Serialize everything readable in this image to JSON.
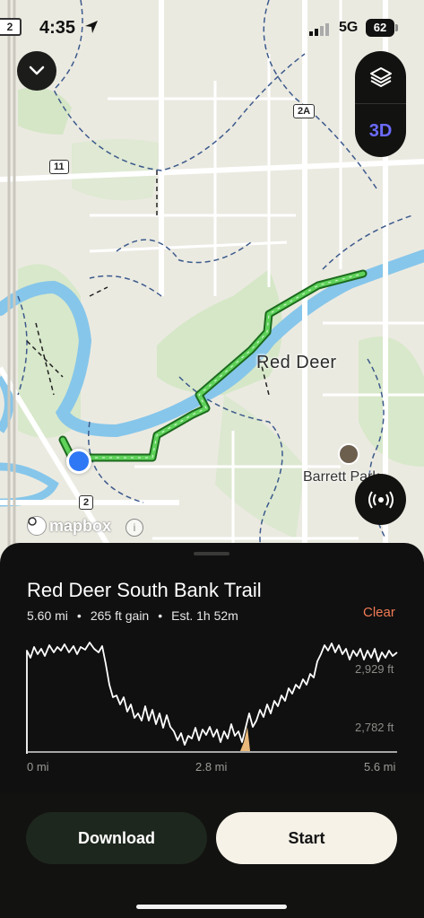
{
  "status_bar": {
    "time": "4:35",
    "network": "5G",
    "battery": "62",
    "badge": "2"
  },
  "map": {
    "highway_labels": [
      "2A",
      "11",
      "2"
    ],
    "city_label": "Red Deer",
    "park_label": "Barrett Park",
    "attribution": "mapbox",
    "three_d_label": "3D"
  },
  "trail": {
    "title": "Red Deer South Bank Trail",
    "distance": "5.60 mi",
    "gain": "265 ft gain",
    "estimate": "Est. 1h 52m",
    "clear_label": "Clear"
  },
  "elevation": {
    "max_label": "2,929 ft",
    "min_label": "2,782 ft",
    "x_start": "0 mi",
    "x_mid": "2.8 mi",
    "x_end": "5.6 mi",
    "route_color": "#5fd25a",
    "highlight_color": "#e9b87a"
  },
  "actions": {
    "download_label": "Download",
    "start_label": "Start"
  }
}
